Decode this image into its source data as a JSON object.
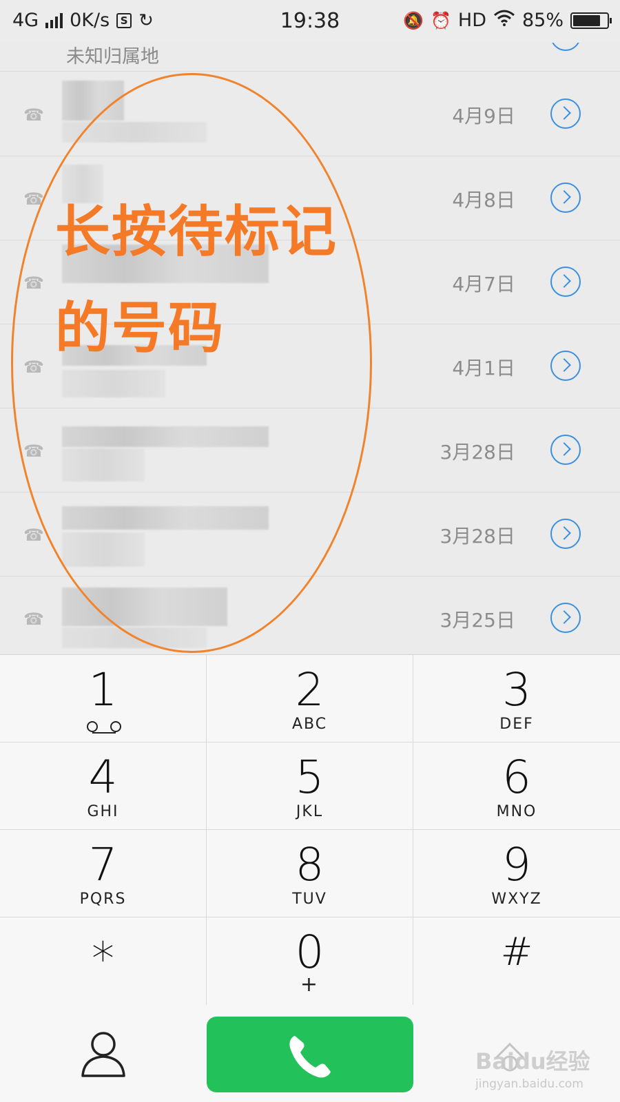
{
  "status_bar": {
    "network": "4G",
    "speed": "0K/s",
    "s_icon": "S",
    "time": "19:38",
    "hd": "HD",
    "battery": "85%"
  },
  "calls": [
    {
      "subtitle": "未知归属地",
      "date": ""
    },
    {
      "date": "4月9日"
    },
    {
      "date": "4月8日"
    },
    {
      "date": "4月7日"
    },
    {
      "date": "4月1日"
    },
    {
      "date": "3月28日"
    },
    {
      "date": "3月28日"
    },
    {
      "date": "3月25日"
    }
  ],
  "annotation": {
    "line1": "长按待标记",
    "line2": "的号码",
    "color": "#f47a28"
  },
  "keypad": [
    {
      "digit": "1",
      "letters": ""
    },
    {
      "digit": "2",
      "letters": "ABC"
    },
    {
      "digit": "3",
      "letters": "DEF"
    },
    {
      "digit": "4",
      "letters": "GHI"
    },
    {
      "digit": "5",
      "letters": "JKL"
    },
    {
      "digit": "6",
      "letters": "MNO"
    },
    {
      "digit": "7",
      "letters": "PQRS"
    },
    {
      "digit": "8",
      "letters": "TUV"
    },
    {
      "digit": "9",
      "letters": "WXYZ"
    },
    {
      "digit": "*",
      "letters": ""
    },
    {
      "digit": "0",
      "letters": "+"
    },
    {
      "digit": "#",
      "letters": ""
    }
  ],
  "colors": {
    "accent_blue": "#3b8fe0",
    "call_green": "#22c15a"
  },
  "watermark": {
    "brand": "Baidu经验",
    "url": "jingyan.baidu.com"
  }
}
